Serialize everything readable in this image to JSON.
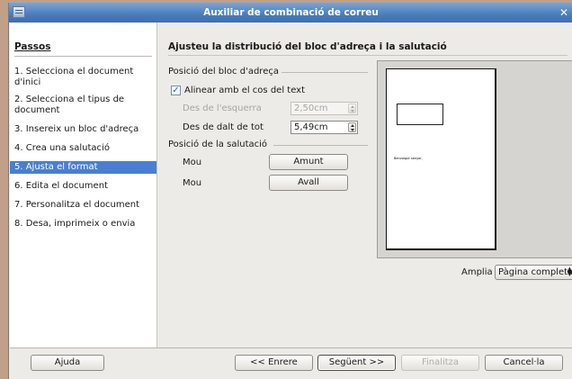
{
  "window": {
    "title": "Auxiliar de combinació de correu",
    "close_glyph": "✕"
  },
  "steps": {
    "header": "Passos",
    "items": [
      {
        "label": "1. Selecciona el document d'inici",
        "active": false
      },
      {
        "label": "2. Selecciona el tipus de document",
        "active": false
      },
      {
        "label": "3. Insereix un bloc d'adreça",
        "active": false
      },
      {
        "label": "4. Crea una salutació",
        "active": false
      },
      {
        "label": "5. Ajusta el format",
        "active": true
      },
      {
        "label": "6. Edita el document",
        "active": false
      },
      {
        "label": "7. Personalitza el document",
        "active": false
      },
      {
        "label": "8. Desa, imprimeix o envia",
        "active": false
      }
    ]
  },
  "main": {
    "title": "Ajusteu la distribució del bloc d'adreça i la salutació",
    "address_group": {
      "label": "Posició del bloc d'adreça",
      "align_checkbox_label": "Alinear amb el cos del text",
      "align_checked": true,
      "from_left_label": "Des de l'esquerra",
      "from_left_value": "2,50cm",
      "from_top_label": "Des de dalt de tot",
      "from_top_value": "5,49cm"
    },
    "salutation_group": {
      "label": "Posició de la salutació",
      "move_label_1": "Mou",
      "up_button": "Amunt",
      "move_label_2": "Mou",
      "down_button": "Avall"
    },
    "preview": {
      "salutation_text": "Benvolgut senyor,"
    },
    "zoom": {
      "label": "Amplia",
      "value": "Pàgina completa"
    }
  },
  "buttons": {
    "help": "Ajuda",
    "back": "<< Enrere",
    "next": "Següent >>",
    "finish": "Finalitza",
    "cancel": "Cancel·la"
  },
  "colors": {
    "title_bar": "#4a7cbc",
    "selection": "#4a7ed4",
    "window_bg": "#edebe8",
    "desktop": "#c0a089"
  }
}
